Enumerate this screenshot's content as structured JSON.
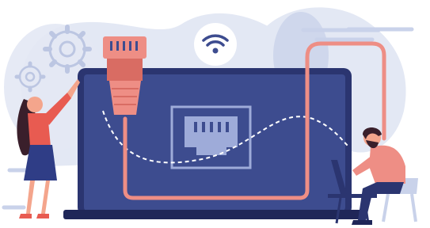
{
  "scene": {
    "colors": {
      "blob_light": "#E3E8F4",
      "blob_mid": "#C9D2EA",
      "gear": "#BCC6E2",
      "laptop_screen": "#3D4C8F",
      "laptop_bezel": "#2B3570",
      "laptop_base": "#1F2658",
      "cable": "#EE8E85",
      "cable_dark": "#D96C63",
      "port_frame": "#9EABD9",
      "dash": "#FFFFFF",
      "wifi_circle": "#FFFFFF",
      "wifi_icon": "#3D4C8F",
      "woman_dress": "#2F3D86",
      "woman_top": "#E85B51",
      "skin": "#F4A58C",
      "hair": "#3A1F2B",
      "man_shirt": "#EE8E85",
      "man_pants": "#2B3570",
      "chair": "#C9D2EA",
      "desk_laptop": "#2B3570"
    },
    "icons": [
      "gear-icon",
      "wifi-icon",
      "ethernet-port-icon",
      "ethernet-plug-icon"
    ]
  }
}
